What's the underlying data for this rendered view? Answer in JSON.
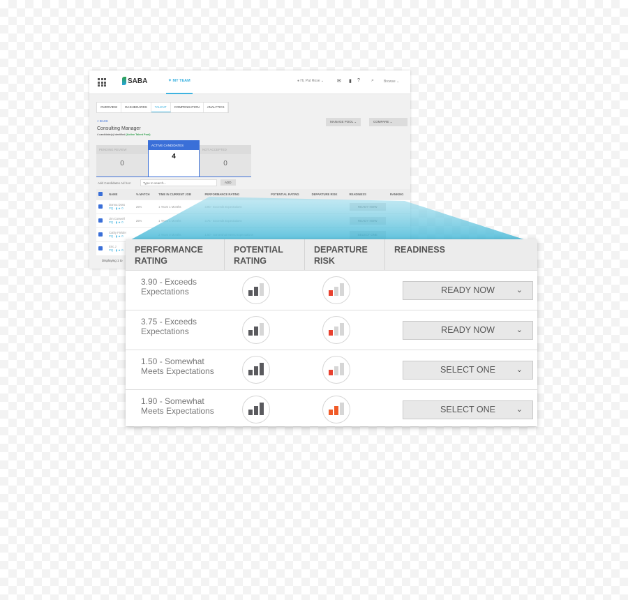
{
  "app": {
    "logo": "SABA",
    "nav_label": "MY TEAM",
    "user": "Hi, Pat Rose",
    "browse": "Browse",
    "tabs": [
      "OVERVIEW",
      "DASHBOARDS",
      "TALENT",
      "COMPENSATION",
      "ANALYTICS"
    ],
    "active_tab": "TALENT",
    "back": "< BACK",
    "title": "Consulting Manager",
    "subtitle": "4 candidate(s) identified",
    "pool": "(Active Talent Pool)",
    "manage_pool": "MANAGE POOL",
    "compare": "COMPARE",
    "cards": [
      {
        "label": "PENDING REVIEW",
        "count": "0"
      },
      {
        "label": "ACTIVE CANDIDATES",
        "count": "4"
      },
      {
        "label": "NOT ACCEPTED",
        "count": "0"
      }
    ],
    "add_label": "Add Candidates Ad hoc:",
    "search_placeholder": "Type to search...",
    "add_button": "ADD",
    "columns": [
      "NAME",
      "% MATCH",
      "TIME IN CURRENT JOB",
      "PERFORMANCE RATING",
      "POTENTIAL RATING",
      "DEPARTURE RISK",
      "READINESS",
      "RANKING"
    ],
    "rows": [
      {
        "name": "Donna Doss",
        "match": "25%",
        "time": "1 Years 1 Months",
        "perf": "3.90 - Exceeds Expectations",
        "readiness": "READY NOW"
      },
      {
        "name": "Jim Conwell",
        "match": "25%",
        "time": "1 Years 1 Months",
        "perf": "3.75 - Exceeds Expectations",
        "readiness": "READY NOW"
      },
      {
        "name": "Cathy Fielder",
        "match": "",
        "time": "2 Years 0 Months",
        "perf": "1.50 - Somewhat Meets Expectations",
        "readiness": "SELECT ONE"
      },
      {
        "name": "Eric J",
        "match": "",
        "time": "",
        "perf": "",
        "readiness": ""
      }
    ],
    "footer": "Displaying 1 to"
  },
  "panel": {
    "headers": [
      "PERFORMANCE RATING",
      "POTENTIAL RATING",
      "DEPARTURE RISK",
      "READINESS"
    ],
    "rows": [
      {
        "performance": "3.90 - Exceeds Expectations",
        "potential_level": 2,
        "departure_level": 1,
        "departure_color": "#e8412f",
        "readiness": "READY NOW"
      },
      {
        "performance": "3.75 - Exceeds Expectations",
        "potential_level": 2,
        "departure_level": 1,
        "departure_color": "#e8412f",
        "readiness": "READY NOW"
      },
      {
        "performance": "1.50 - Somewhat Meets Expectations",
        "potential_level": 3,
        "departure_level": 1,
        "departure_color": "#e8412f",
        "readiness": "SELECT ONE"
      },
      {
        "performance": "1.90 - Somewhat Meets Expectations",
        "potential_level": 3,
        "departure_level": 2,
        "departure_color": "#f05a28",
        "readiness": "SELECT ONE"
      }
    ]
  },
  "colors": {
    "accent": "#3fb3e0",
    "primary": "#3a6fd8",
    "potential": "#5a5a5e",
    "bar_inactive": "#d6d6d6"
  }
}
